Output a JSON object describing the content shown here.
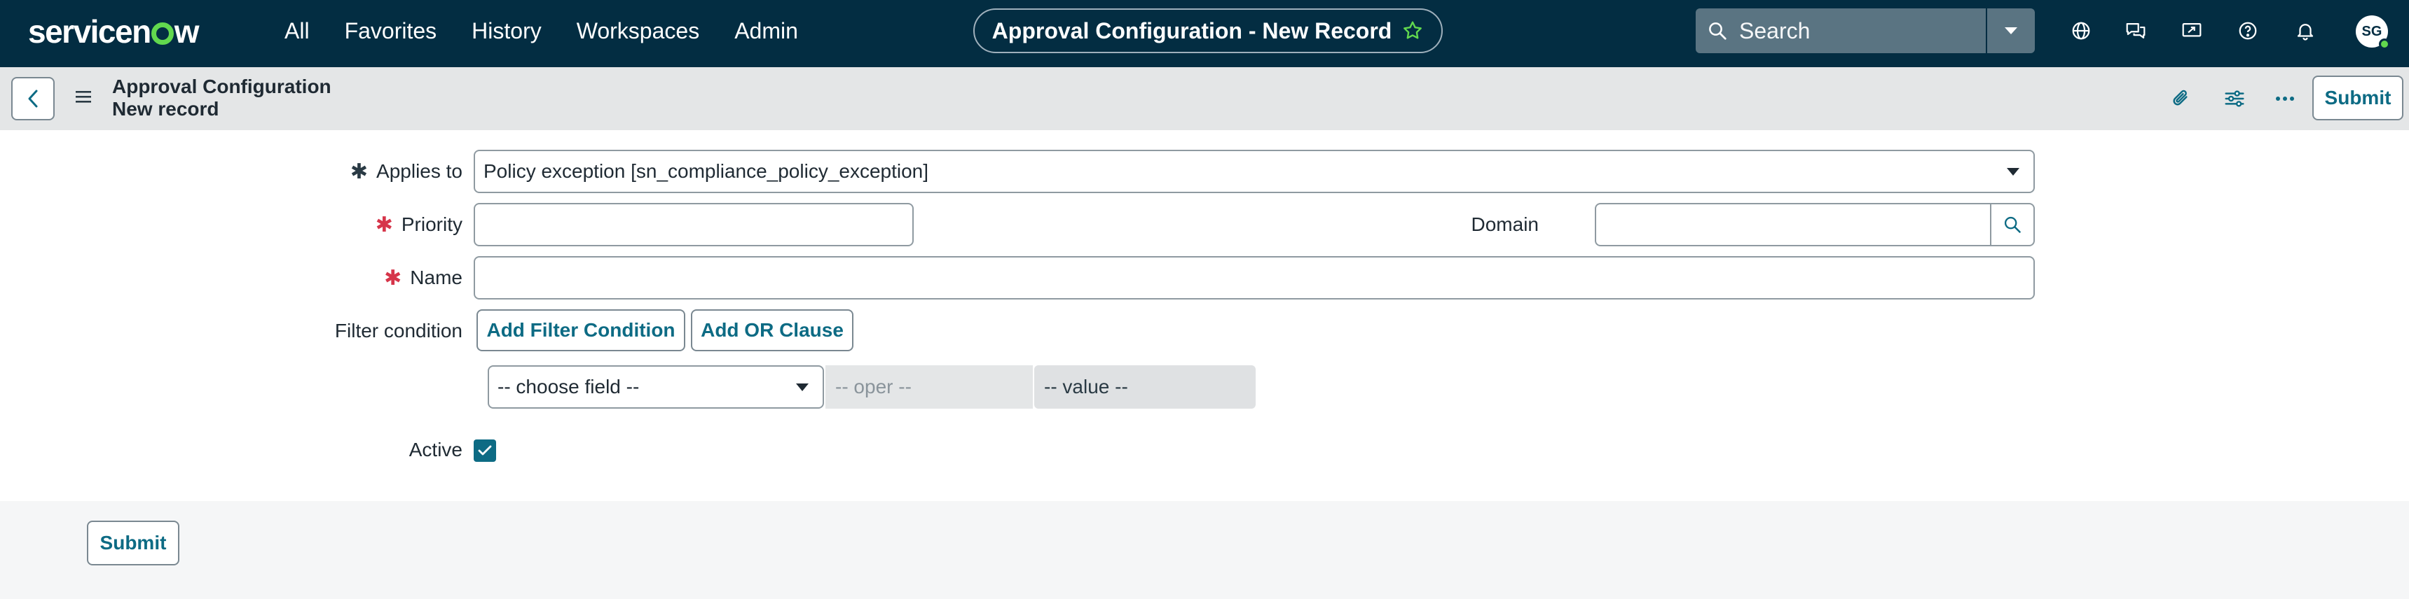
{
  "brand": {
    "logo_pre": "servicen",
    "logo_post": "w",
    "accent": "#62d84e"
  },
  "nav": {
    "items": [
      "All",
      "Favorites",
      "History",
      "Workspaces",
      "Admin"
    ]
  },
  "record_pill": {
    "label": "Approval Configuration - New Record",
    "icon": "star-outline-icon"
  },
  "search": {
    "label": "Search"
  },
  "user": {
    "initials": "SG",
    "status_color": "#62d84e"
  },
  "header": {
    "title_line1": "Approval Configuration",
    "title_line2": "New record",
    "submit_label": "Submit"
  },
  "form": {
    "applies_to": {
      "label": "Applies to",
      "value": "Policy exception [sn_compliance_policy_exception]"
    },
    "priority": {
      "label": "Priority",
      "value": ""
    },
    "domain": {
      "label": "Domain",
      "value": ""
    },
    "name": {
      "label": "Name",
      "value": ""
    },
    "filter": {
      "label": "Filter condition",
      "add_filter_label": "Add Filter Condition",
      "add_or_label": "Add OR Clause",
      "field_placeholder": "-- choose field --",
      "oper_placeholder": "-- oper --",
      "value_placeholder": "-- value --"
    },
    "active": {
      "label": "Active",
      "checked": true
    }
  },
  "footer": {
    "submit_label": "Submit"
  },
  "colors": {
    "nav_bg": "#032d42",
    "link_teal": "#0d6b84",
    "required_red": "#d6354a"
  }
}
